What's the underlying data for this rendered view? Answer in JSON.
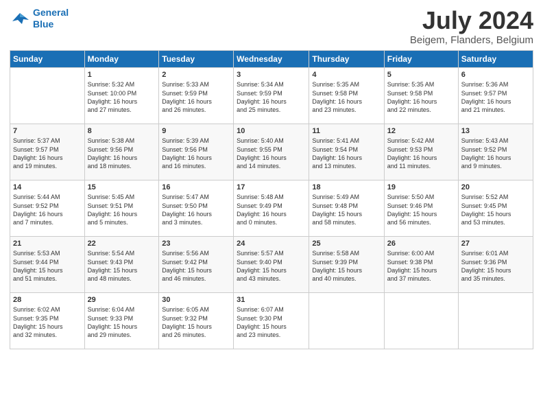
{
  "logo": {
    "line1": "General",
    "line2": "Blue"
  },
  "header": {
    "month": "July 2024",
    "location": "Beigem, Flanders, Belgium"
  },
  "weekdays": [
    "Sunday",
    "Monday",
    "Tuesday",
    "Wednesday",
    "Thursday",
    "Friday",
    "Saturday"
  ],
  "weeks": [
    [
      {
        "day": "",
        "info": ""
      },
      {
        "day": "1",
        "info": "Sunrise: 5:32 AM\nSunset: 10:00 PM\nDaylight: 16 hours\nand 27 minutes."
      },
      {
        "day": "2",
        "info": "Sunrise: 5:33 AM\nSunset: 9:59 PM\nDaylight: 16 hours\nand 26 minutes."
      },
      {
        "day": "3",
        "info": "Sunrise: 5:34 AM\nSunset: 9:59 PM\nDaylight: 16 hours\nand 25 minutes."
      },
      {
        "day": "4",
        "info": "Sunrise: 5:35 AM\nSunset: 9:58 PM\nDaylight: 16 hours\nand 23 minutes."
      },
      {
        "day": "5",
        "info": "Sunrise: 5:35 AM\nSunset: 9:58 PM\nDaylight: 16 hours\nand 22 minutes."
      },
      {
        "day": "6",
        "info": "Sunrise: 5:36 AM\nSunset: 9:57 PM\nDaylight: 16 hours\nand 21 minutes."
      }
    ],
    [
      {
        "day": "7",
        "info": "Sunrise: 5:37 AM\nSunset: 9:57 PM\nDaylight: 16 hours\nand 19 minutes."
      },
      {
        "day": "8",
        "info": "Sunrise: 5:38 AM\nSunset: 9:56 PM\nDaylight: 16 hours\nand 18 minutes."
      },
      {
        "day": "9",
        "info": "Sunrise: 5:39 AM\nSunset: 9:56 PM\nDaylight: 16 hours\nand 16 minutes."
      },
      {
        "day": "10",
        "info": "Sunrise: 5:40 AM\nSunset: 9:55 PM\nDaylight: 16 hours\nand 14 minutes."
      },
      {
        "day": "11",
        "info": "Sunrise: 5:41 AM\nSunset: 9:54 PM\nDaylight: 16 hours\nand 13 minutes."
      },
      {
        "day": "12",
        "info": "Sunrise: 5:42 AM\nSunset: 9:53 PM\nDaylight: 16 hours\nand 11 minutes."
      },
      {
        "day": "13",
        "info": "Sunrise: 5:43 AM\nSunset: 9:52 PM\nDaylight: 16 hours\nand 9 minutes."
      }
    ],
    [
      {
        "day": "14",
        "info": "Sunrise: 5:44 AM\nSunset: 9:52 PM\nDaylight: 16 hours\nand 7 minutes."
      },
      {
        "day": "15",
        "info": "Sunrise: 5:45 AM\nSunset: 9:51 PM\nDaylight: 16 hours\nand 5 minutes."
      },
      {
        "day": "16",
        "info": "Sunrise: 5:47 AM\nSunset: 9:50 PM\nDaylight: 16 hours\nand 3 minutes."
      },
      {
        "day": "17",
        "info": "Sunrise: 5:48 AM\nSunset: 9:49 PM\nDaylight: 16 hours\nand 0 minutes."
      },
      {
        "day": "18",
        "info": "Sunrise: 5:49 AM\nSunset: 9:48 PM\nDaylight: 15 hours\nand 58 minutes."
      },
      {
        "day": "19",
        "info": "Sunrise: 5:50 AM\nSunset: 9:46 PM\nDaylight: 15 hours\nand 56 minutes."
      },
      {
        "day": "20",
        "info": "Sunrise: 5:52 AM\nSunset: 9:45 PM\nDaylight: 15 hours\nand 53 minutes."
      }
    ],
    [
      {
        "day": "21",
        "info": "Sunrise: 5:53 AM\nSunset: 9:44 PM\nDaylight: 15 hours\nand 51 minutes."
      },
      {
        "day": "22",
        "info": "Sunrise: 5:54 AM\nSunset: 9:43 PM\nDaylight: 15 hours\nand 48 minutes."
      },
      {
        "day": "23",
        "info": "Sunrise: 5:56 AM\nSunset: 9:42 PM\nDaylight: 15 hours\nand 46 minutes."
      },
      {
        "day": "24",
        "info": "Sunrise: 5:57 AM\nSunset: 9:40 PM\nDaylight: 15 hours\nand 43 minutes."
      },
      {
        "day": "25",
        "info": "Sunrise: 5:58 AM\nSunset: 9:39 PM\nDaylight: 15 hours\nand 40 minutes."
      },
      {
        "day": "26",
        "info": "Sunrise: 6:00 AM\nSunset: 9:38 PM\nDaylight: 15 hours\nand 37 minutes."
      },
      {
        "day": "27",
        "info": "Sunrise: 6:01 AM\nSunset: 9:36 PM\nDaylight: 15 hours\nand 35 minutes."
      }
    ],
    [
      {
        "day": "28",
        "info": "Sunrise: 6:02 AM\nSunset: 9:35 PM\nDaylight: 15 hours\nand 32 minutes."
      },
      {
        "day": "29",
        "info": "Sunrise: 6:04 AM\nSunset: 9:33 PM\nDaylight: 15 hours\nand 29 minutes."
      },
      {
        "day": "30",
        "info": "Sunrise: 6:05 AM\nSunset: 9:32 PM\nDaylight: 15 hours\nand 26 minutes."
      },
      {
        "day": "31",
        "info": "Sunrise: 6:07 AM\nSunset: 9:30 PM\nDaylight: 15 hours\nand 23 minutes."
      },
      {
        "day": "",
        "info": ""
      },
      {
        "day": "",
        "info": ""
      },
      {
        "day": "",
        "info": ""
      }
    ]
  ]
}
